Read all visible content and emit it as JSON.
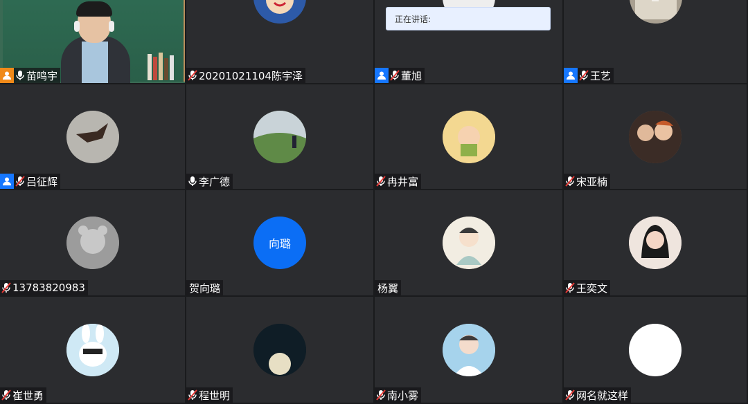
{
  "speaking_popup": {
    "label": "正在讲话:"
  },
  "participants": [
    {
      "name": "苗鸣宇",
      "video": true,
      "host_badge": true,
      "mic": "on"
    },
    {
      "name": "20201021104陈宇泽",
      "avatar_color": "#2d5aa8",
      "mic": "off"
    },
    {
      "name": "董旭",
      "avatar_color": "#d8d8d8",
      "host_badge": true,
      "mic": "off"
    },
    {
      "name": "王艺",
      "avatar_color": "#b9b2a5",
      "host_badge": true,
      "mic": "off"
    },
    {
      "name": "吕征辉",
      "avatar_color": "#9a9a95",
      "host_badge": true,
      "mic": "off"
    },
    {
      "name": "李广德",
      "avatar_color": "#6b8f5a",
      "mic": "on"
    },
    {
      "name": "冉井富",
      "avatar_color": "#f0d28a",
      "mic": "off"
    },
    {
      "name": "宋亚楠",
      "avatar_color": "#6a4a3a",
      "mic": "off"
    },
    {
      "name": "13783820983",
      "avatar_color": "#8a8a8a",
      "mic": "off"
    },
    {
      "name": "贺向璐",
      "avatar_text": "向璐",
      "avatar_color": "#0b6ef5",
      "mic": "none"
    },
    {
      "name": "杨翼",
      "avatar_color": "#e9e0cf",
      "mic": "none"
    },
    {
      "name": "王奕文",
      "avatar_color": "#e7d8d0",
      "mic": "off"
    },
    {
      "name": "崔世勇",
      "avatar_color": "#d7eef6",
      "mic": "off"
    },
    {
      "name": "程世明",
      "avatar_color": "#0d1b24",
      "mic": "off"
    },
    {
      "name": "南小雾",
      "avatar_color": "#a7d2ea",
      "mic": "off"
    },
    {
      "name": "网名就这样",
      "avatar_color": "#ffffff",
      "mic": "off"
    }
  ],
  "colors": {
    "host_badge": "#1677ff",
    "host_badge_video": "#f08a19",
    "tile_bg": "#2b2c2f"
  }
}
